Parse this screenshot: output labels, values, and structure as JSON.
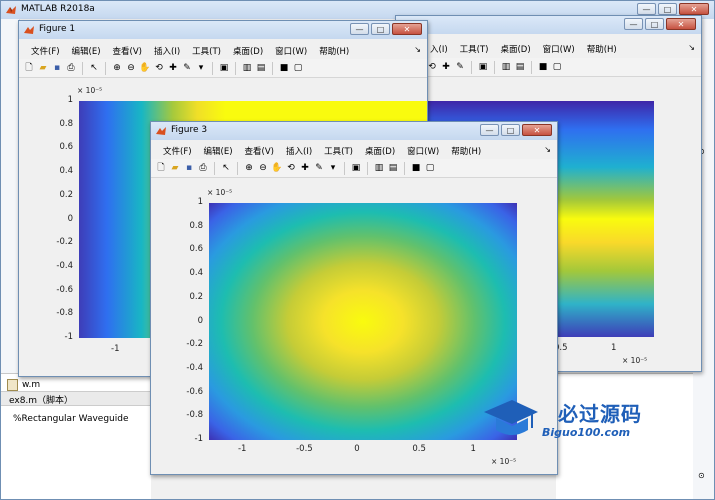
{
  "main_window": {
    "title": "MATLAB R2018a",
    "editor_file": "w.m",
    "script_label": "ex8.m（脚本）",
    "editor_comment": "%Rectangular Waveguide"
  },
  "menu_items": [
    "文件(F)",
    "编辑(E)",
    "查看(V)",
    "插入(I)",
    "工具(T)",
    "桌面(D)",
    "窗口(W)",
    "帮助(H)"
  ],
  "menu_items_partial": [
    "入(I)",
    "工具(T)",
    "桌面(D)",
    "窗口(W)",
    "帮助(H)"
  ],
  "figure1": {
    "title": "Figure 1",
    "yaxis_exp": "× 10⁻⁵",
    "yticks": [
      "1",
      "0.8",
      "0.6",
      "0.4",
      "0.2",
      "0",
      "-0.2",
      "-0.4",
      "-0.6",
      "-0.8",
      "-1"
    ],
    "xticks_visible": [
      "-1"
    ]
  },
  "figure2": {
    "xticks_visible": [
      "0.5",
      "1"
    ],
    "xaxis_exp": "× 10⁻⁵"
  },
  "figure3": {
    "title": "Figure 3",
    "yaxis_exp": "× 10⁻⁵",
    "xaxis_exp": "× 10⁻⁵",
    "yticks": [
      "1",
      "0.8",
      "0.6",
      "0.4",
      "0.2",
      "0",
      "-0.2",
      "-0.4",
      "-0.6",
      "-0.8",
      "-1"
    ],
    "xticks": [
      "-1",
      "-0.5",
      "0",
      "0.5",
      "1"
    ]
  },
  "watermark": {
    "brand": "必过源码",
    "site": "Biguo100.com"
  },
  "colors": {
    "parula_low": "#3e26a8",
    "parula_mid": "#13beb7",
    "parula_high": "#f9fb0e",
    "title_bar": "#c5d8ef",
    "close_button": "#c65241"
  }
}
